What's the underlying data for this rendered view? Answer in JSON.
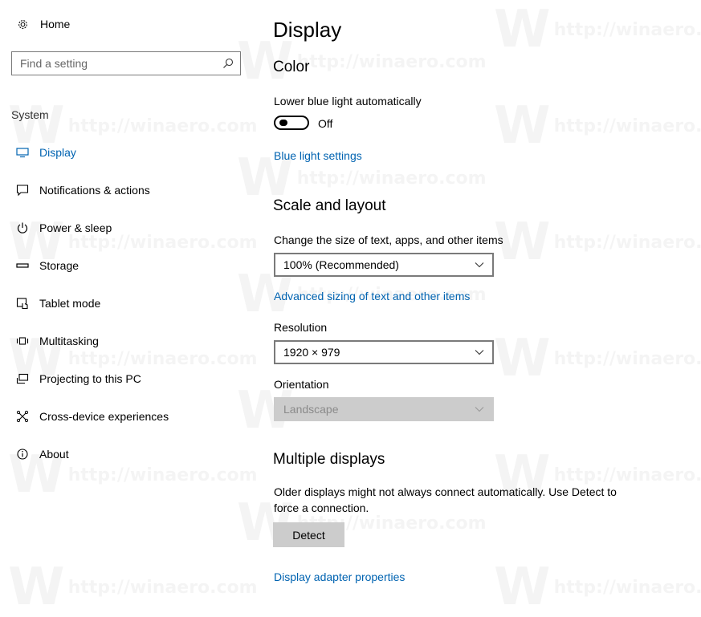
{
  "watermark": {
    "letter": "W",
    "text": "http://winaero.com"
  },
  "sidebar": {
    "home_label": "Home",
    "search_placeholder": "Find a setting",
    "section_label": "System",
    "items": [
      {
        "label": "Display",
        "icon": "monitor-icon",
        "active": true
      },
      {
        "label": "Notifications & actions",
        "icon": "notification-icon"
      },
      {
        "label": "Power & sleep",
        "icon": "power-icon"
      },
      {
        "label": "Storage",
        "icon": "storage-icon"
      },
      {
        "label": "Tablet mode",
        "icon": "tablet-icon"
      },
      {
        "label": "Multitasking",
        "icon": "multitasking-icon"
      },
      {
        "label": "Projecting to this PC",
        "icon": "projecting-icon"
      },
      {
        "label": "Cross-device experiences",
        "icon": "cross-device-icon"
      },
      {
        "label": "About",
        "icon": "info-icon"
      }
    ]
  },
  "main": {
    "title": "Display",
    "color": {
      "heading": "Color",
      "lower_blue_light_label": "Lower blue light automatically",
      "toggle_state": "Off",
      "blue_light_link": "Blue light settings"
    },
    "scale": {
      "heading": "Scale and layout",
      "size_label": "Change the size of text, apps, and other items",
      "size_value": "100% (Recommended)",
      "advanced_link": "Advanced sizing of text and other items",
      "resolution_label": "Resolution",
      "resolution_value": "1920 × 979",
      "orientation_label": "Orientation",
      "orientation_value": "Landscape"
    },
    "multiple": {
      "heading": "Multiple displays",
      "description": "Older displays might not always connect automatically. Use Detect to force a connection.",
      "detect_button": "Detect",
      "adapter_link": "Display adapter properties"
    }
  },
  "colors": {
    "accent": "#0063b1",
    "disabled_bg": "#cccccc",
    "border": "#7a7a7a"
  }
}
